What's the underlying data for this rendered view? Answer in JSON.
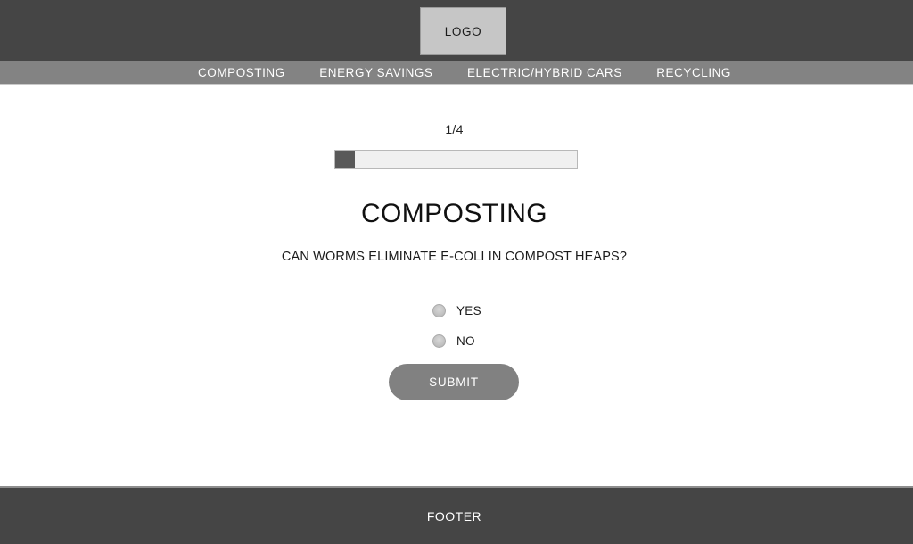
{
  "header": {
    "logo_label": "LOGO",
    "background_color": "#454545",
    "logo_box_color": "#c6c6c6"
  },
  "nav": {
    "background_color": "#838383",
    "items": [
      {
        "label": "COMPOSTING"
      },
      {
        "label": "ENERGY SAVINGS"
      },
      {
        "label": "ELECTRIC/HYBRID CARS"
      },
      {
        "label": "RECYCLING"
      }
    ]
  },
  "quiz": {
    "progress_label": "1/4",
    "progress_current": 1,
    "progress_total": 4,
    "progress_fill_color": "#595959",
    "progress_track_color": "#f0f0f0",
    "title": "COMPOSTING",
    "question": "CAN WORMS ELIMINATE E-COLI IN COMPOST HEAPS?",
    "options": [
      {
        "label": "YES",
        "selected": false
      },
      {
        "label": "NO",
        "selected": false
      }
    ],
    "submit_label": "SUBMIT",
    "submit_color": "#818181"
  },
  "footer": {
    "label": "FOOTER",
    "background_color": "#454545"
  }
}
